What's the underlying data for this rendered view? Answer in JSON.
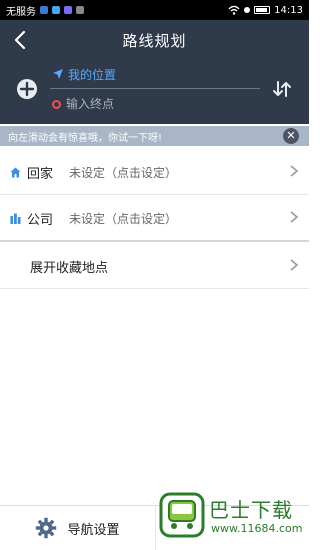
{
  "status": {
    "carrier": "无服务",
    "time": "14:13"
  },
  "header": {
    "title": "路线规划"
  },
  "route": {
    "start_label": "我的位置",
    "end_placeholder": "输入终点"
  },
  "tip": {
    "text": "向左滑动会有惊喜哦，你试一下呀!"
  },
  "places": [
    {
      "label": "回家",
      "value": "未设定（点击设定）"
    },
    {
      "label": "公司",
      "value": "未设定（点击设定）"
    }
  ],
  "expand_favorites": {
    "label": "展开收藏地点"
  },
  "bottom": {
    "nav_settings_label": "导航设置"
  },
  "watermark": {
    "text": "巴士下载",
    "url": "www.11684.com"
  },
  "colors": {
    "header_bg": "#2f3a4a",
    "accent_blue": "#5aa8ff",
    "destination_red": "#ff4a4a",
    "tip_bg": "#a9b6c7"
  }
}
